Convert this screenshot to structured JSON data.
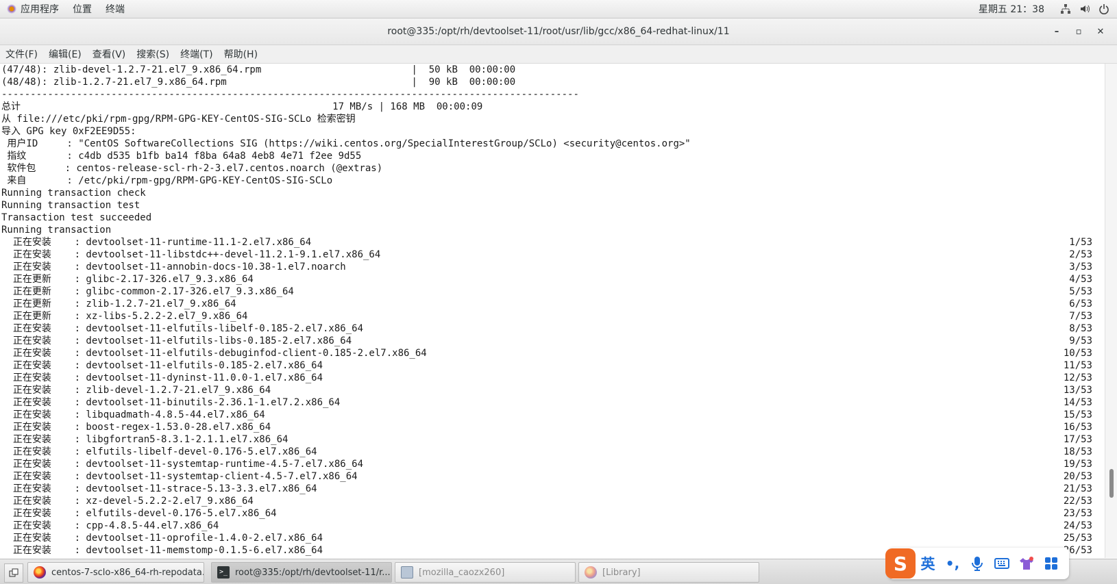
{
  "topbar": {
    "applications": "应用程序",
    "places": "位置",
    "terminal": "终端",
    "clock": "星期五 21：38",
    "icons": [
      "network-icon",
      "volume-icon",
      "power-icon"
    ]
  },
  "window": {
    "title": "root@335:/opt/rh/devtoolset-11/root/usr/lib/gcc/x86_64-redhat-linux/11",
    "minimize": "–",
    "maximize": "▫",
    "close": "✕"
  },
  "menubar": [
    "文件(F)",
    "编辑(E)",
    "查看(V)",
    "搜索(S)",
    "终端(T)",
    "帮助(H)"
  ],
  "terminal_lines": [
    {
      "left": "(47/48): zlib-devel-1.2.7-21.el7_9.x86_64.rpm                          |  50 kB  00:00:00",
      "right": ""
    },
    {
      "left": "(48/48): zlib-1.2.7-21.el7_9.x86_64.rpm                                |  90 kB  00:00:00",
      "right": ""
    },
    {
      "left": "----------------------------------------------------------------------------------------------------",
      "right": ""
    },
    {
      "left": "总计                                                      17 MB/s | 168 MB  00:00:09",
      "right": ""
    },
    {
      "left": "从 file:///etc/pki/rpm-gpg/RPM-GPG-KEY-CentOS-SIG-SCLo 检索密钥",
      "right": ""
    },
    {
      "left": "导入 GPG key 0xF2EE9D55:",
      "right": ""
    },
    {
      "left": " 用户ID     : \"CentOS SoftwareCollections SIG (https://wiki.centos.org/SpecialInterestGroup/SCLo) <security@centos.org>\"",
      "right": ""
    },
    {
      "left": " 指纹       : c4db d535 b1fb ba14 f8ba 64a8 4eb8 4e71 f2ee 9d55",
      "right": ""
    },
    {
      "left": " 软件包     : centos-release-scl-rh-2-3.el7.centos.noarch (@extras)",
      "right": ""
    },
    {
      "left": " 来自       : /etc/pki/rpm-gpg/RPM-GPG-KEY-CentOS-SIG-SCLo",
      "right": ""
    },
    {
      "left": "Running transaction check",
      "right": ""
    },
    {
      "left": "Running transaction test",
      "right": ""
    },
    {
      "left": "Transaction test succeeded",
      "right": ""
    },
    {
      "left": "Running transaction",
      "right": ""
    },
    {
      "left": "  正在安装    : devtoolset-11-runtime-11.1-2.el7.x86_64",
      "right": "1/53"
    },
    {
      "left": "  正在安装    : devtoolset-11-libstdc++-devel-11.2.1-9.1.el7.x86_64",
      "right": "2/53"
    },
    {
      "left": "  正在安装    : devtoolset-11-annobin-docs-10.38-1.el7.noarch",
      "right": "3/53"
    },
    {
      "left": "  正在更新    : glibc-2.17-326.el7_9.3.x86_64",
      "right": "4/53"
    },
    {
      "left": "  正在更新    : glibc-common-2.17-326.el7_9.3.x86_64",
      "right": "5/53"
    },
    {
      "left": "  正在更新    : zlib-1.2.7-21.el7_9.x86_64",
      "right": "6/53"
    },
    {
      "left": "  正在更新    : xz-libs-5.2.2-2.el7_9.x86_64",
      "right": "7/53"
    },
    {
      "left": "  正在安装    : devtoolset-11-elfutils-libelf-0.185-2.el7.x86_64",
      "right": "8/53"
    },
    {
      "left": "  正在安装    : devtoolset-11-elfutils-libs-0.185-2.el7.x86_64",
      "right": "9/53"
    },
    {
      "left": "  正在安装    : devtoolset-11-elfutils-debuginfod-client-0.185-2.el7.x86_64",
      "right": "10/53"
    },
    {
      "left": "  正在安装    : devtoolset-11-elfutils-0.185-2.el7.x86_64",
      "right": "11/53"
    },
    {
      "left": "  正在安装    : devtoolset-11-dyninst-11.0.0-1.el7.x86_64",
      "right": "12/53"
    },
    {
      "left": "  正在安装    : zlib-devel-1.2.7-21.el7_9.x86_64",
      "right": "13/53"
    },
    {
      "left": "  正在安装    : devtoolset-11-binutils-2.36.1-1.el7.2.x86_64",
      "right": "14/53"
    },
    {
      "left": "  正在安装    : libquadmath-4.8.5-44.el7.x86_64",
      "right": "15/53"
    },
    {
      "left": "  正在安装    : boost-regex-1.53.0-28.el7.x86_64",
      "right": "16/53"
    },
    {
      "left": "  正在安装    : libgfortran5-8.3.1-2.1.1.el7.x86_64",
      "right": "17/53"
    },
    {
      "left": "  正在安装    : elfutils-libelf-devel-0.176-5.el7.x86_64",
      "right": "18/53"
    },
    {
      "left": "  正在安装    : devtoolset-11-systemtap-runtime-4.5-7.el7.x86_64",
      "right": "19/53"
    },
    {
      "left": "  正在安装    : devtoolset-11-systemtap-client-4.5-7.el7.x86_64",
      "right": "20/53"
    },
    {
      "left": "  正在安装    : devtoolset-11-strace-5.13-3.3.el7.x86_64",
      "right": "21/53"
    },
    {
      "left": "  正在安装    : xz-devel-5.2.2-2.el7_9.x86_64",
      "right": "22/53"
    },
    {
      "left": "  正在安装    : elfutils-devel-0.176-5.el7.x86_64",
      "right": "23/53"
    },
    {
      "left": "  正在安装    : cpp-4.8.5-44.el7.x86_64",
      "right": "24/53"
    },
    {
      "left": "  正在安装    : devtoolset-11-oprofile-1.4.0-2.el7.x86_64",
      "right": "25/53"
    },
    {
      "left": "  正在安装    : devtoolset-11-memstomp-0.1.5-6.el7.x86_64",
      "right": "26/53"
    }
  ],
  "taskbar": {
    "tasks": [
      {
        "label": "centos-7-sclo-x86_64-rh-repodata...",
        "icon": "firefox-icon"
      },
      {
        "label": "root@335:/opt/rh/devtoolset-11/r...",
        "icon": "terminal-icon"
      },
      {
        "label": "[mozilla_caozx260]",
        "icon": "file-manager-icon"
      },
      {
        "label": "[Library]",
        "icon": "firefox-icon"
      }
    ]
  },
  "ime": {
    "logo": "S",
    "lang": "英",
    "punct": "•,",
    "icons": [
      "logo-icon",
      "mic-icon",
      "keyboard-icon",
      "skin-icon",
      "apps-grid-icon"
    ]
  }
}
